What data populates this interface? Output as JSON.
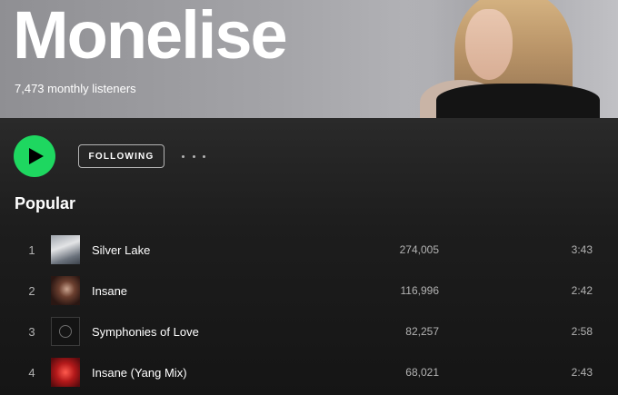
{
  "artist": {
    "name": "Monelise",
    "monthly_listeners": "7,473 monthly listeners"
  },
  "controls": {
    "follow_label": "FOLLOWING",
    "play_icon": "play-icon",
    "more_icon": "more-options-icon"
  },
  "popular": {
    "title": "Popular",
    "tracks": [
      {
        "number": "1",
        "title": "Silver Lake",
        "plays": "274,005",
        "duration": "3:43"
      },
      {
        "number": "2",
        "title": "Insane",
        "plays": "116,996",
        "duration": "2:42"
      },
      {
        "number": "3",
        "title": "Symphonies of Love",
        "plays": "82,257",
        "duration": "2:58"
      },
      {
        "number": "4",
        "title": "Insane (Yang Mix)",
        "plays": "68,021",
        "duration": "2:43"
      }
    ]
  },
  "colors": {
    "accent": "#1ed760",
    "background": "#121212",
    "secondary_text": "#b3b3b3"
  }
}
